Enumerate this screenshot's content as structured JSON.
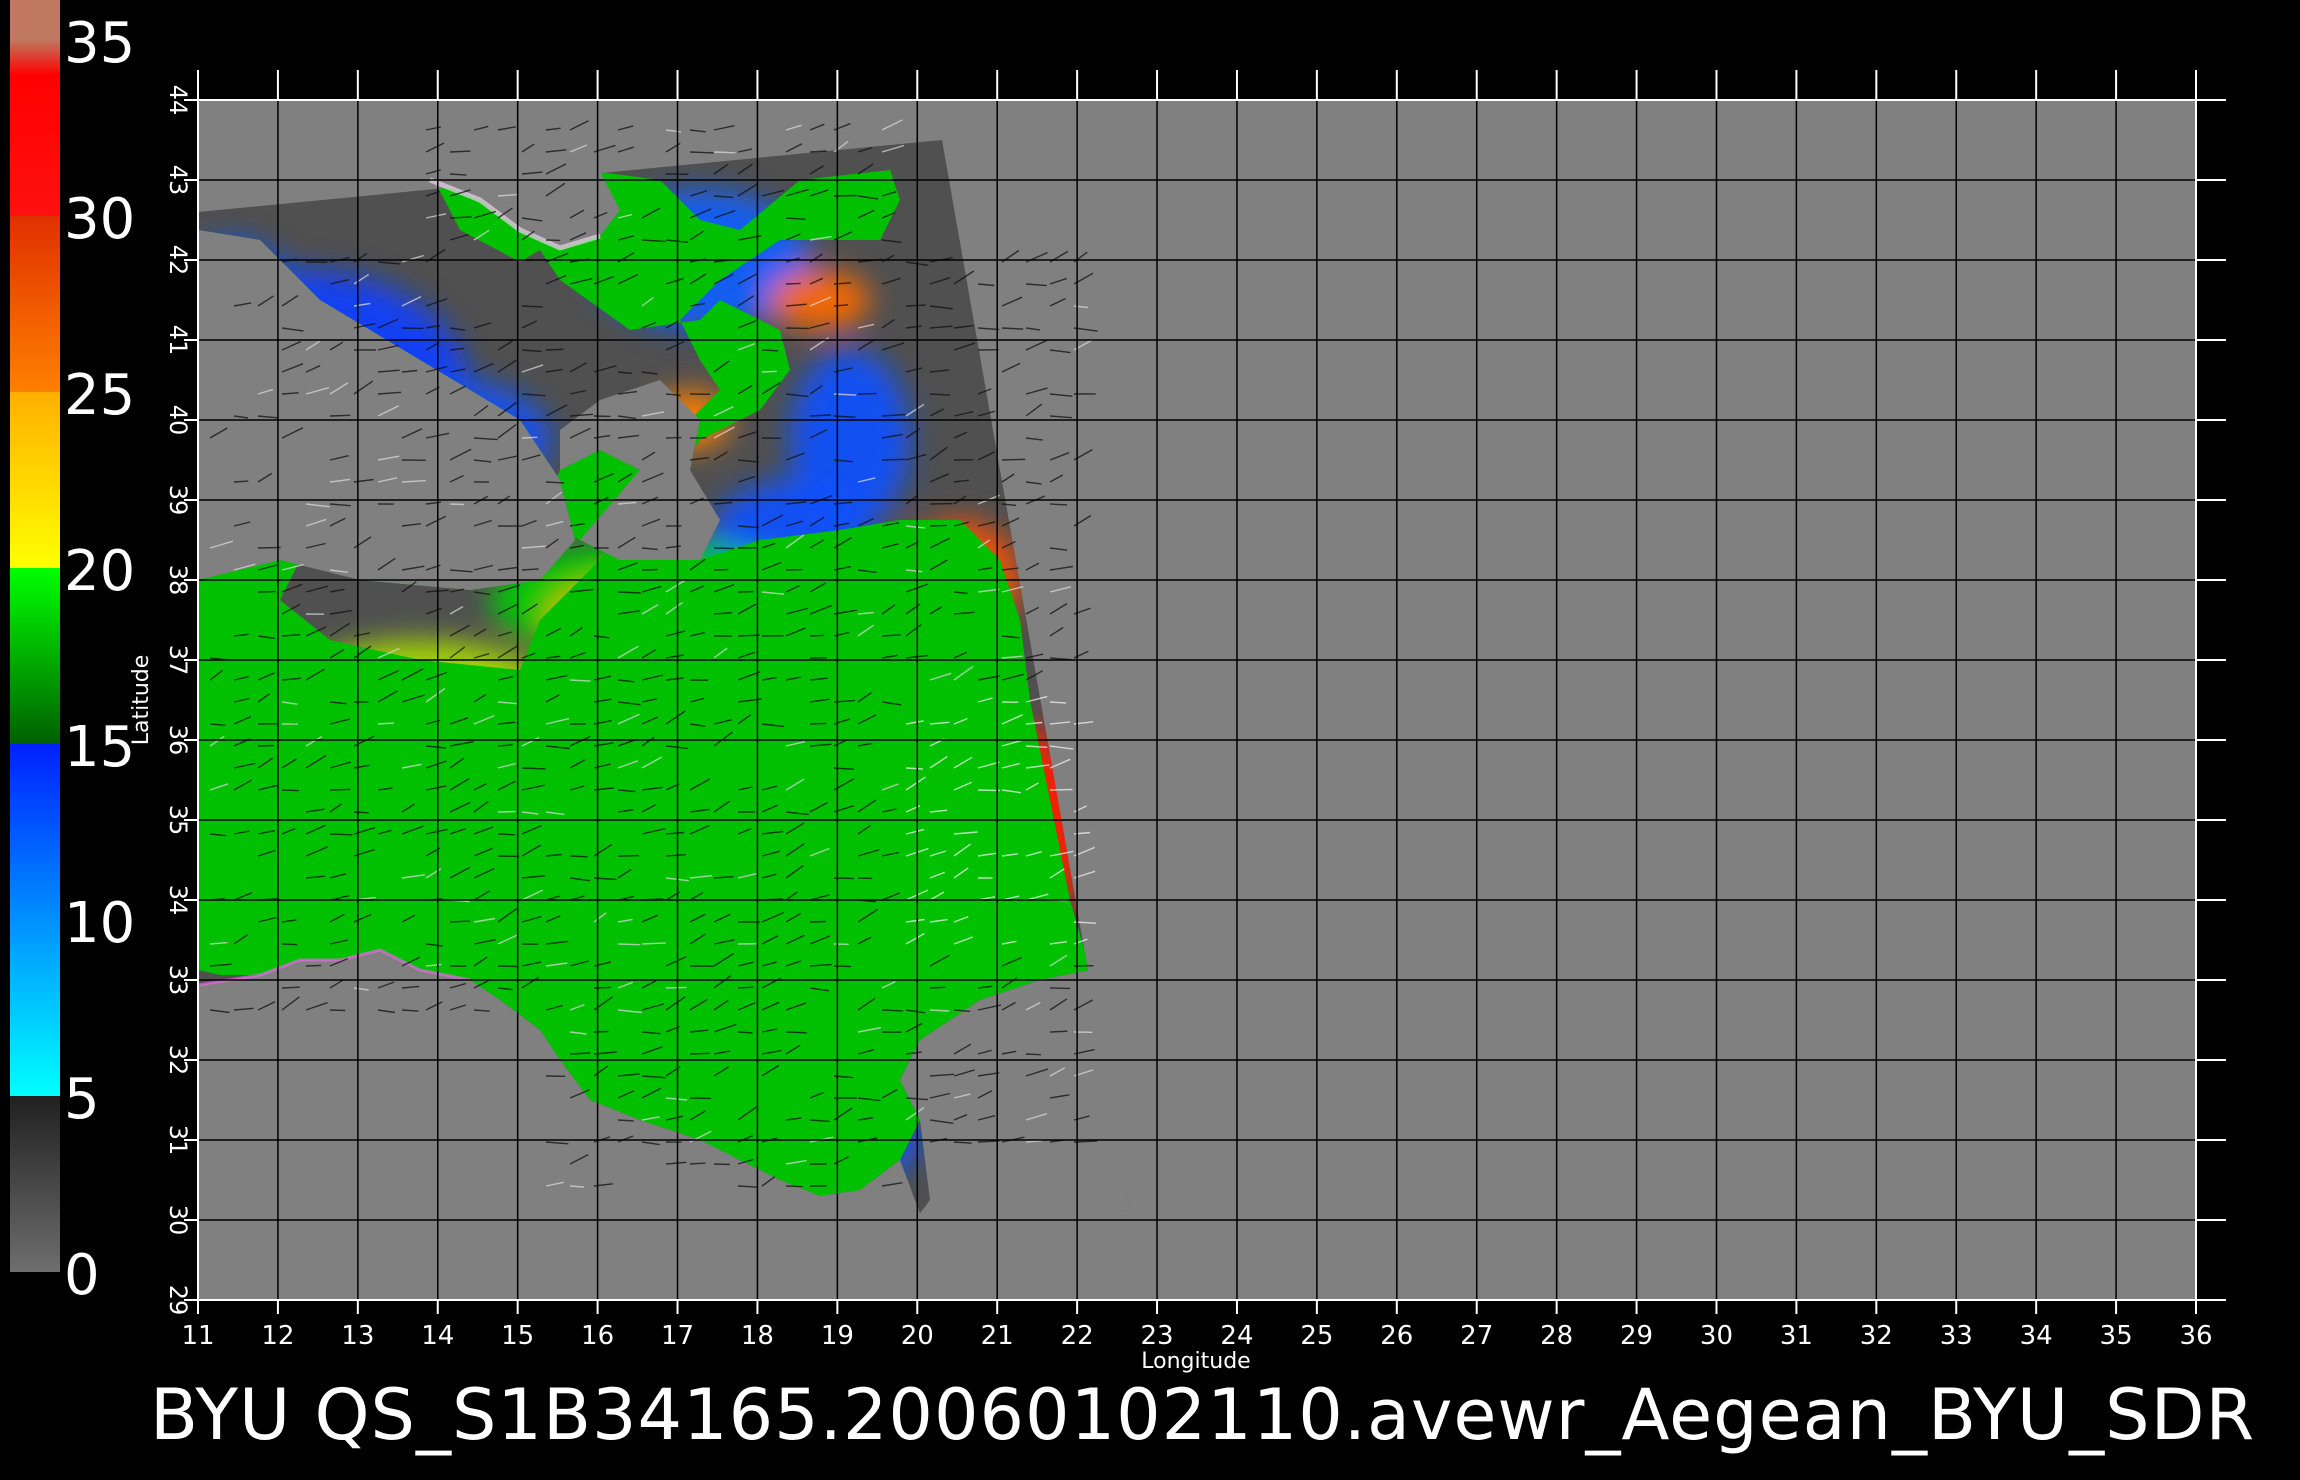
{
  "map": {
    "xlabel": "Longitude",
    "ylabel": "Latitude",
    "lon_range": [
      11,
      36
    ],
    "lat_range": [
      29,
      44
    ],
    "lon_ticks": [
      "11",
      "12",
      "13",
      "14",
      "15",
      "16",
      "17",
      "18",
      "19",
      "20",
      "21",
      "22",
      "23",
      "24",
      "25",
      "26",
      "27",
      "28",
      "29",
      "30",
      "31",
      "32",
      "33",
      "34",
      "35",
      "36"
    ],
    "lat_ticks": [
      "29",
      "30",
      "31",
      "32",
      "33",
      "34",
      "35",
      "36",
      "37",
      "38",
      "39",
      "40",
      "41",
      "42",
      "43",
      "44"
    ],
    "grid": true,
    "background_color": "#808080",
    "swath_color": "#505050",
    "land_color": "#808080"
  },
  "colorbar": {
    "min": 0,
    "max": 35,
    "labels": [
      "35",
      "30",
      "25",
      "20",
      "15",
      "10",
      "5",
      "0"
    ],
    "position": "left",
    "stops": [
      {
        "value": 0,
        "color": "#6e6e6e"
      },
      {
        "value": 5,
        "color": "#202020"
      },
      {
        "value": 5,
        "color": "#00ffff"
      },
      {
        "value": 10,
        "color": "#0090ff"
      },
      {
        "value": 15,
        "color": "#0020ff"
      },
      {
        "value": 15,
        "color": "#006000"
      },
      {
        "value": 20,
        "color": "#00ff00"
      },
      {
        "value": 20,
        "color": "#ffff00"
      },
      {
        "value": 25,
        "color": "#ffb000"
      },
      {
        "value": 25,
        "color": "#ff8000"
      },
      {
        "value": 30,
        "color": "#e03000"
      },
      {
        "value": 30,
        "color": "#ff1010"
      },
      {
        "value": 34,
        "color": "#ff0000"
      },
      {
        "value": 35,
        "color": "#c07860"
      }
    ]
  },
  "footer": {
    "title": "BYU  QS_S1B34165.20060102110.avewr_Aegean_BYU_SDR"
  }
}
